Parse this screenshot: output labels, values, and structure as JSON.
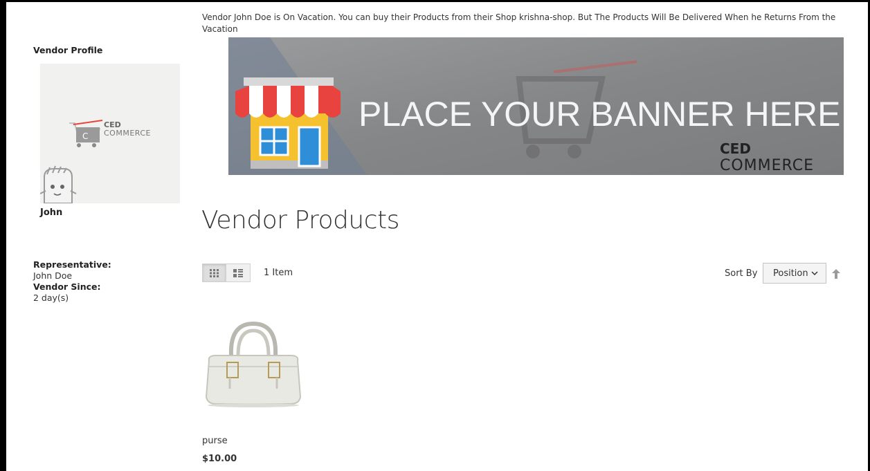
{
  "notice": {
    "text": "Vendor John Doe is On Vacation. You can buy their Products from their Shop krishna-shop. But The Products Will Be Delivered When he Returns From the Vacation"
  },
  "sidebar": {
    "title": "Vendor Profile",
    "logo_top": "CED",
    "logo_bottom": "COMMERCE",
    "name": "John",
    "representative_label": "Representative:",
    "representative_value": "John Doe",
    "since_label": "Vendor Since:",
    "since_value": "2 day(s)"
  },
  "banner": {
    "text": "PLACE YOUR BANNER HERE",
    "brand_top": "CED",
    "brand_bottom": "COMMERCE"
  },
  "main": {
    "title": "Vendor Products",
    "item_count": "1 Item"
  },
  "toolbar": {
    "sort_label": "Sort By",
    "sort_selected": "Position",
    "grid_icon": "grid-icon",
    "list_icon": "list-icon",
    "sort_dir_icon": "arrow-up-icon"
  },
  "products": [
    {
      "name": "purse",
      "price": "$10.00"
    }
  ],
  "colors": {
    "text": "#333333",
    "banner_bg": "#8a8b8d",
    "awning_red": "#e8433f",
    "shop_yellow": "#f6c12e",
    "shop_blue": "#2f8ed8"
  }
}
